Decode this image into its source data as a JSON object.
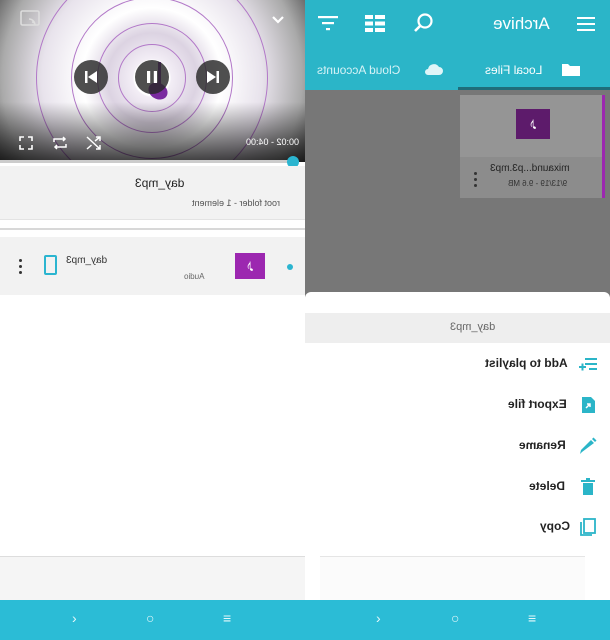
{
  "player": {
    "time_current": "00:02",
    "time_total": "04:00",
    "time_display": "00:02 - 04:00",
    "progress": 0.97
  },
  "current_file": {
    "name": "day_mp3",
    "location": "root folder - 1 element"
  },
  "file_list": [
    {
      "name": "day_mp3",
      "type": "Audio"
    }
  ],
  "archive": {
    "title": "Archive",
    "tabs": [
      {
        "label": "Local Files",
        "active": true
      },
      {
        "label": "Cloud Accounts",
        "active": false
      }
    ],
    "card": {
      "name": "mixaund...p3.mp3",
      "meta": "9/13/19 - 9.6 MB"
    }
  },
  "sheet": {
    "title": "day_mp3",
    "items": [
      {
        "label": "Add to playlist",
        "icon": "playlist-add-icon"
      },
      {
        "label": "Export file",
        "icon": "export-file-icon"
      },
      {
        "label": "Rename",
        "icon": "pencil-icon"
      },
      {
        "label": "Delete",
        "icon": "trash-icon"
      },
      {
        "label": "Copy",
        "icon": "copy-icon"
      }
    ]
  },
  "colors": {
    "accent": "#2bb5c8",
    "nav": "#2bbcd6",
    "thumb": "#9c27b0"
  }
}
